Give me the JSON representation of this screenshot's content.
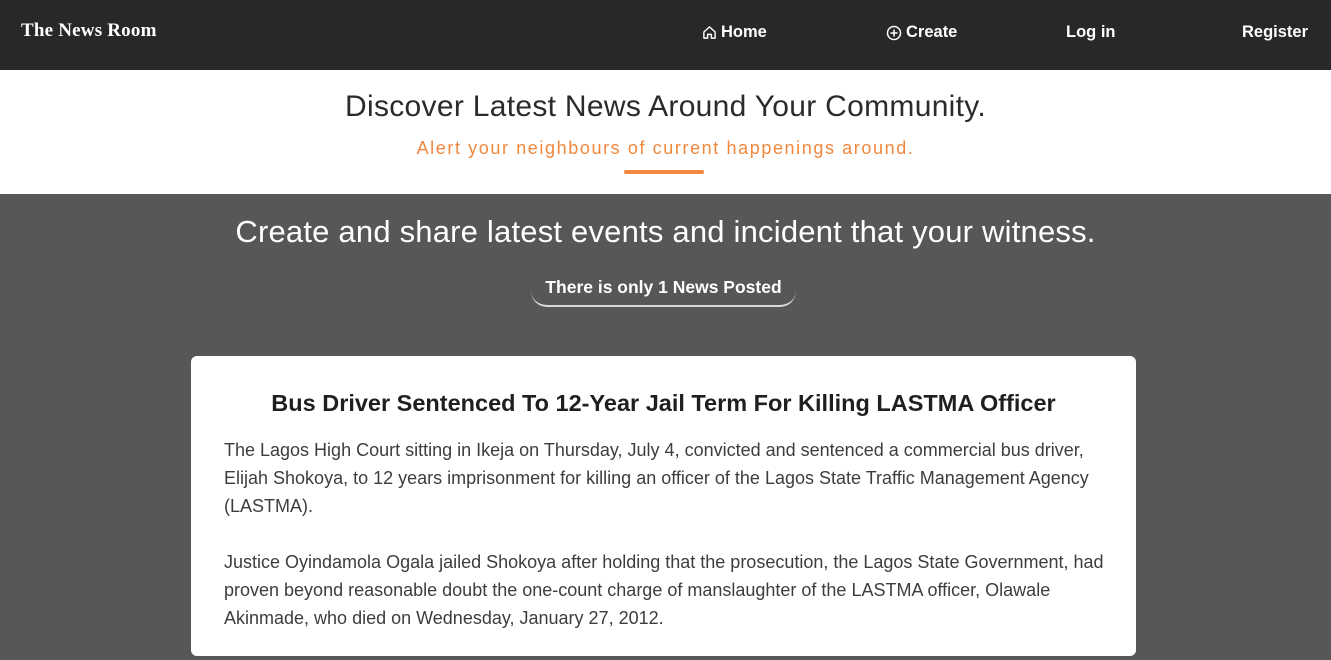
{
  "navbar": {
    "brand": "The News Room",
    "links": {
      "home": "Home",
      "create": "Create",
      "login": "Log in",
      "register": "Register"
    }
  },
  "hero": {
    "title": "Discover Latest News Around Your Community.",
    "subtitle": "Alert your neighbours of current happenings around."
  },
  "main": {
    "title": "Create and share latest events and incident that your witness.",
    "count_text": "There is only 1 News Posted"
  },
  "news": [
    {
      "title": "Bus Driver Sentenced To 12-Year Jail Term For Killing LASTMA Officer",
      "paragraphs": [
        "The Lagos High Court sitting in Ikeja on Thursday, July 4, convicted and sentenced a commercial bus driver, Elijah Shokoya, to 12 years imprisonment for killing an officer of the Lagos State Traffic Management Agency (LASTMA).",
        "Justice Oyindamola Ogala jailed Shokoya after holding that the prosecution, the Lagos State Government, had proven beyond reasonable doubt the one-count charge of manslaughter of the LASTMA officer, Olawale Akinmade, who died on Wednesday, January 27, 2012."
      ]
    }
  ],
  "colors": {
    "navbar_bg": "#282828",
    "accent": "#f0883e",
    "page_bg": "#575757"
  },
  "icons": {
    "home": "home-icon",
    "create": "plus-circle-icon"
  }
}
